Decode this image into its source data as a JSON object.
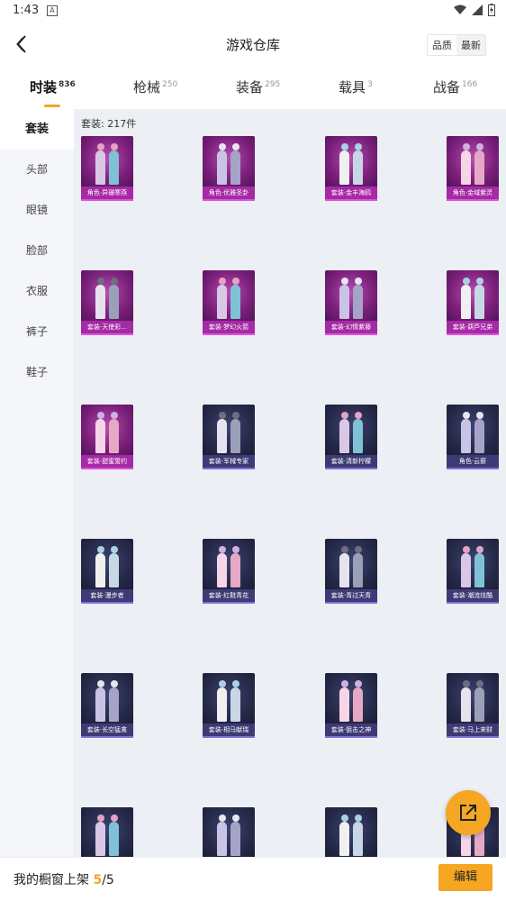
{
  "status": {
    "time": "1:43",
    "notif_glyph": "A"
  },
  "header": {
    "title": "游戏仓库",
    "sort_options": [
      "品质",
      "最新"
    ]
  },
  "tabs": [
    {
      "label": "时装",
      "count": "836"
    },
    {
      "label": "枪械",
      "count": "250"
    },
    {
      "label": "装备",
      "count": "295"
    },
    {
      "label": "载具",
      "count": "3"
    },
    {
      "label": "战备",
      "count": "166"
    }
  ],
  "sidebar": {
    "items": [
      "套装",
      "头部",
      "眼镜",
      "脸部",
      "衣服",
      "裤子",
      "鞋子"
    ]
  },
  "content": {
    "count_label": "套装: 217件",
    "items": [
      {
        "label": "角色·异珊寒燕",
        "style": "pink"
      },
      {
        "label": "角色·优雅圣卦",
        "style": "pink"
      },
      {
        "label": "套装·金丰海鸥",
        "style": "pink"
      },
      {
        "label": "角色·金域紫灵",
        "style": "pink"
      },
      {
        "label": "套装·天使彩...",
        "style": "pink"
      },
      {
        "label": "套装·梦幻火箭",
        "style": "pink"
      },
      {
        "label": "套装·幻情紫藤",
        "style": "pink"
      },
      {
        "label": "套装·葫芦兄弟",
        "style": "pink"
      },
      {
        "label": "套装·甜蜜誓约",
        "style": "pink"
      },
      {
        "label": "套装·军械专家",
        "style": "dark"
      },
      {
        "label": "套装·清新柠檬",
        "style": "dark"
      },
      {
        "label": "角色·云薪",
        "style": "dark"
      },
      {
        "label": "套装·漫步者",
        "style": "dark"
      },
      {
        "label": "套装·红鞋青花",
        "style": "dark"
      },
      {
        "label": "套装·青过天青",
        "style": "dark"
      },
      {
        "label": "套装·潮流炫酷",
        "style": "dark"
      },
      {
        "label": "套装·长空猛禽",
        "style": "dark"
      },
      {
        "label": "套装·相马献瑞",
        "style": "dark"
      },
      {
        "label": "套装·狙击之神",
        "style": "dark"
      },
      {
        "label": "套装·马上来财",
        "style": "dark"
      },
      {
        "label": "",
        "style": "dark"
      },
      {
        "label": "",
        "style": "dark"
      },
      {
        "label": "",
        "style": "dark"
      },
      {
        "label": "",
        "style": "dark"
      }
    ]
  },
  "footer": {
    "prefix": "我的橱窗上架 ",
    "current": "5",
    "separator": "/",
    "total": "5",
    "edit_label": "编辑"
  },
  "colors": {
    "accent": "#f5a623",
    "pink_card": "#a52aa5",
    "dark_card": "#3e3a75"
  }
}
